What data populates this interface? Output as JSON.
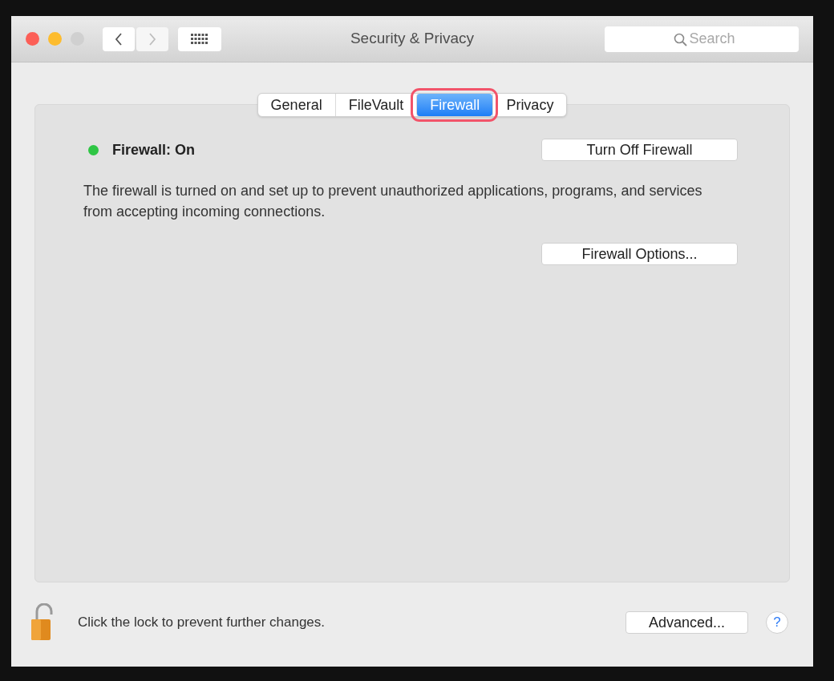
{
  "window": {
    "title": "Security & Privacy",
    "zoom_disabled": true
  },
  "nav": [
    {
      "kind": "back",
      "disabled": false
    },
    {
      "kind": "forward",
      "disabled": true
    }
  ],
  "search": {
    "placeholder": "Search"
  },
  "tabs": [
    {
      "label": "General",
      "selected": false,
      "highlighted": false
    },
    {
      "label": "FileVault",
      "selected": false,
      "highlighted": false
    },
    {
      "label": "Firewall",
      "selected": true,
      "highlighted": true
    },
    {
      "label": "Privacy",
      "selected": false,
      "highlighted": false
    }
  ],
  "firewall": {
    "status": "Firewall: On",
    "on": true,
    "toggle_button": "Turn Off Firewall",
    "description": "The firewall is turned on and set up to prevent unauthorized applications, programs, and services from accepting incoming connections.",
    "options_button": "Firewall Options..."
  },
  "footer": {
    "lock_text": "Click the lock to prevent further changes.",
    "unlocked": true,
    "advanced_button": "Advanced...",
    "help": "?"
  }
}
